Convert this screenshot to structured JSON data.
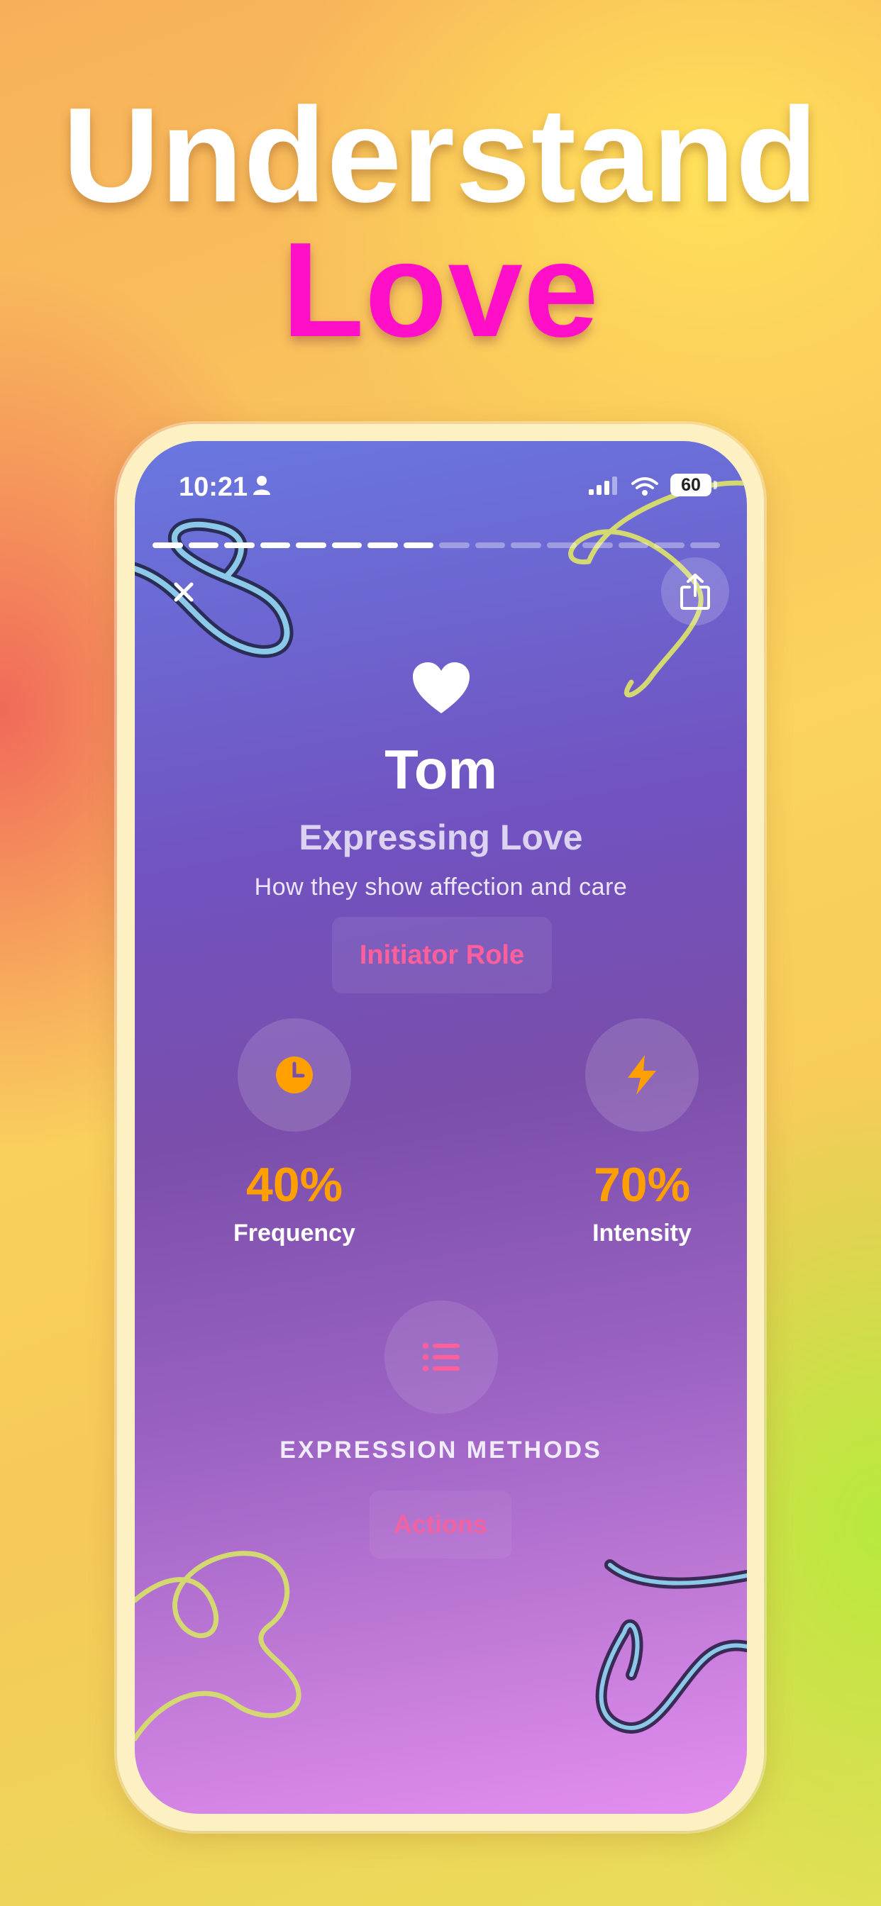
{
  "headline": {
    "line1": "Understand",
    "line2": "Love"
  },
  "status_bar": {
    "time": "10:21",
    "battery": "60"
  },
  "profile": {
    "name": "Tom",
    "title": "Expressing Love",
    "subtitle": "How they show affection and care",
    "role_badge": "Initiator Role"
  },
  "progress": {
    "total_segments": 16,
    "completed_segments": 8
  },
  "stats": [
    {
      "icon": "clock-icon",
      "value": "40%",
      "label": "Frequency"
    },
    {
      "icon": "bolt-icon",
      "value": "70%",
      "label": "Intensity"
    }
  ],
  "methods": {
    "icon": "list-icon",
    "label": "EXPRESSION METHODS",
    "badge": "Actions"
  },
  "colors": {
    "accent_pink": "#ff10c8",
    "stat_orange": "#ffa000",
    "badge_text": "#ff5f9a"
  }
}
